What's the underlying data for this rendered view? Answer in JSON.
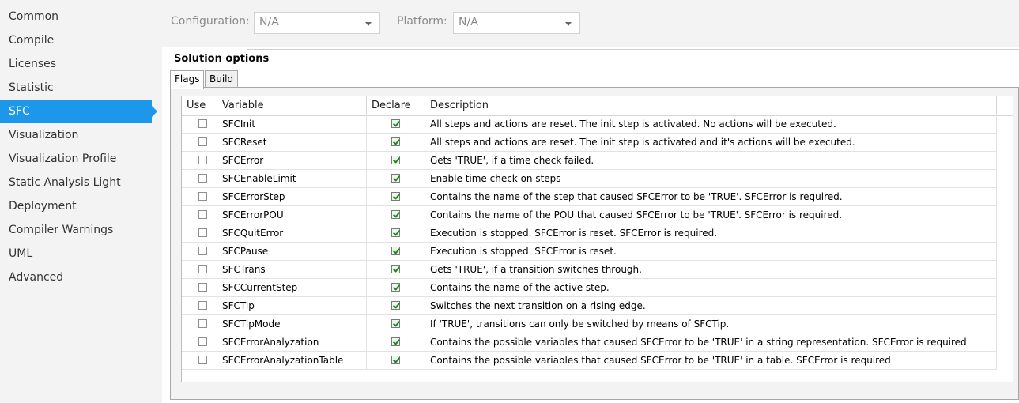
{
  "sidebar": {
    "items": [
      {
        "label": "Common"
      },
      {
        "label": "Compile"
      },
      {
        "label": "Licenses"
      },
      {
        "label": "Statistic"
      },
      {
        "label": "SFC",
        "selected": true
      },
      {
        "label": "Visualization"
      },
      {
        "label": "Visualization Profile"
      },
      {
        "label": "Static Analysis Light"
      },
      {
        "label": "Deployment"
      },
      {
        "label": "Compiler Warnings"
      },
      {
        "label": "UML"
      },
      {
        "label": "Advanced"
      }
    ]
  },
  "toolbar": {
    "configuration_label": "Configuration:",
    "configuration_value": "N/A",
    "platform_label": "Platform:",
    "platform_value": "N/A"
  },
  "section": {
    "title": "Solution options"
  },
  "tabs": [
    {
      "label": "Flags",
      "active": true
    },
    {
      "label": "Build",
      "active": false
    }
  ],
  "table": {
    "columns": [
      "Use",
      "Variable",
      "Declare",
      "Description"
    ],
    "rows": [
      {
        "use": false,
        "variable": "SFCInit",
        "declare": true,
        "description": "All steps and actions are reset. The init step is activated. No actions will be executed."
      },
      {
        "use": false,
        "variable": "SFCReset",
        "declare": true,
        "description": "All steps and actions are reset. The init step is activated and it's actions will be executed."
      },
      {
        "use": false,
        "variable": "SFCError",
        "declare": true,
        "description": "Gets 'TRUE', if a time check failed."
      },
      {
        "use": false,
        "variable": "SFCEnableLimit",
        "declare": true,
        "description": "Enable time check on steps"
      },
      {
        "use": false,
        "variable": "SFCErrorStep",
        "declare": true,
        "description": "Contains the name of the step that caused SFCError to be 'TRUE'. SFCError is required."
      },
      {
        "use": false,
        "variable": "SFCErrorPOU",
        "declare": true,
        "description": "Contains the name of the POU that caused SFCError to be 'TRUE'. SFCError is required."
      },
      {
        "use": false,
        "variable": "SFCQuitError",
        "declare": true,
        "description": "Execution is stopped. SFCError is reset. SFCError is required."
      },
      {
        "use": false,
        "variable": "SFCPause",
        "declare": true,
        "description": "Execution is stopped. SFCError is reset."
      },
      {
        "use": false,
        "variable": "SFCTrans",
        "declare": true,
        "description": "Gets 'TRUE', if a transition switches through."
      },
      {
        "use": false,
        "variable": "SFCCurrentStep",
        "declare": true,
        "description": "Contains the name of the active step."
      },
      {
        "use": false,
        "variable": "SFCTip",
        "declare": true,
        "description": "Switches the next transition on a rising edge."
      },
      {
        "use": false,
        "variable": "SFCTipMode",
        "declare": true,
        "description": "If 'TRUE', transitions can only be switched by means of SFCTip."
      },
      {
        "use": false,
        "variable": "SFCErrorAnalyzation",
        "declare": true,
        "description": "Contains the possible variables that caused SFCError to be 'TRUE' in a string representation. SFCError is required"
      },
      {
        "use": false,
        "variable": "SFCErrorAnalyzationTable",
        "declare": true,
        "description": "Contains the possible variables that caused SFCError to be 'TRUE' in a table. SFCError is required"
      }
    ]
  },
  "colors": {
    "accent": "#1c97ea",
    "sidebar_bg": "#f3f3f3",
    "checkmark": "#1a8a1a"
  }
}
